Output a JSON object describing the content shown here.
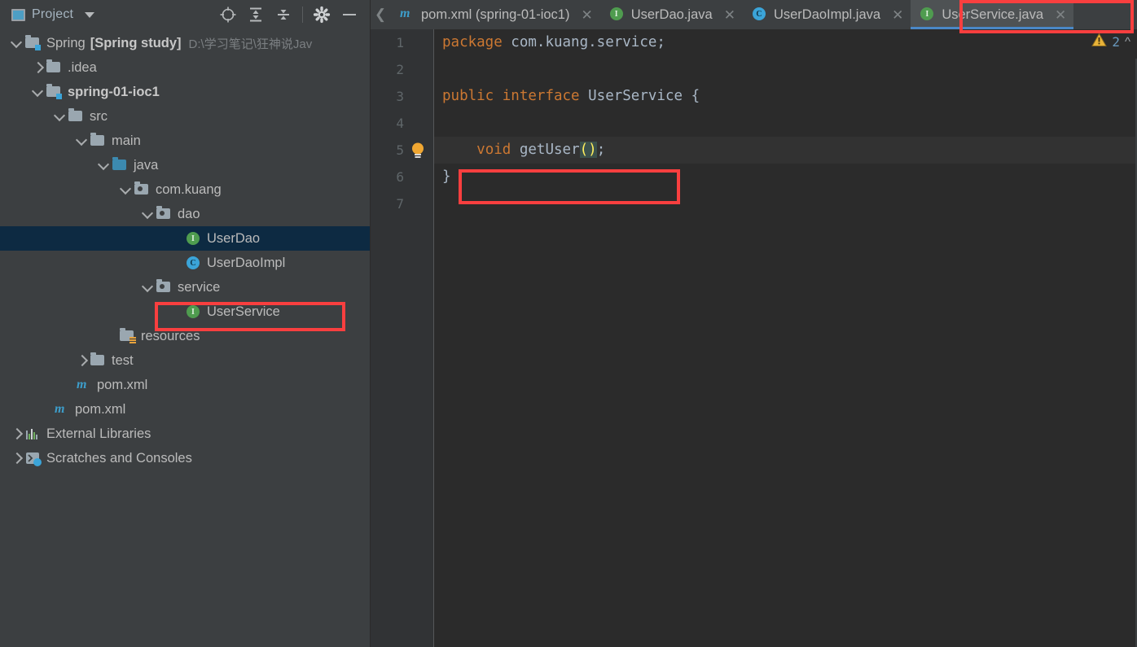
{
  "toolwindow": {
    "title": "Project",
    "window_icon": "project-window-icon",
    "dropdown_icon": "chevron-down-icon",
    "actions": [
      {
        "name": "scroll-from-source-icon",
        "label": "Select Opened File"
      },
      {
        "name": "expand-all-icon",
        "label": "Expand All"
      },
      {
        "name": "collapse-all-icon",
        "label": "Collapse All"
      },
      {
        "name": "gear-icon",
        "label": "Settings"
      },
      {
        "name": "minimize-icon",
        "label": "Hide"
      }
    ]
  },
  "tree": [
    {
      "label": "Spring",
      "bold_label": "[Spring study]",
      "path": "D:\\学习笔记\\狂神说Jav",
      "icon": "module-folder-icon",
      "arrow": "open",
      "depth": 0,
      "selected": false
    },
    {
      "label": ".idea",
      "icon": "folder-icon",
      "arrow": "closed",
      "depth": 1,
      "selected": false
    },
    {
      "label": "spring-01-ioc1",
      "icon": "module-folder-icon",
      "arrow": "open",
      "depth": 1,
      "bold": true,
      "selected": false
    },
    {
      "label": "src",
      "icon": "folder-icon",
      "arrow": "open",
      "depth": 2,
      "selected": false
    },
    {
      "label": "main",
      "icon": "folder-icon",
      "arrow": "open",
      "depth": 3,
      "selected": false
    },
    {
      "label": "java",
      "icon": "source-root-folder-icon",
      "arrow": "open",
      "depth": 4,
      "selected": false
    },
    {
      "label": "com.kuang",
      "icon": "package-icon",
      "arrow": "open",
      "depth": 5,
      "selected": false
    },
    {
      "label": "dao",
      "icon": "package-icon",
      "arrow": "open",
      "depth": 6,
      "selected": false
    },
    {
      "label": "UserDao",
      "icon": "interface-icon",
      "arrow": "none",
      "depth": 7,
      "selected": true
    },
    {
      "label": "UserDaoImpl",
      "icon": "class-icon",
      "arrow": "none",
      "depth": 7,
      "selected": false
    },
    {
      "label": "service",
      "icon": "package-icon",
      "arrow": "open",
      "depth": 6,
      "selected": false
    },
    {
      "label": "UserService",
      "icon": "interface-icon",
      "arrow": "none",
      "depth": 7,
      "selected": false,
      "annotated": true
    },
    {
      "label": "resources",
      "icon": "resources-folder-icon",
      "arrow": "none",
      "depth": 4,
      "selected": false
    },
    {
      "label": "test",
      "icon": "folder-icon",
      "arrow": "closed",
      "depth": 3,
      "selected": false
    },
    {
      "label": "pom.xml",
      "icon": "maven-icon",
      "arrow": "none",
      "depth": 3,
      "selected": false
    },
    {
      "label": "pom.xml",
      "icon": "maven-icon",
      "arrow": "none",
      "depth": 2,
      "selected": false
    },
    {
      "label": "External Libraries",
      "icon": "external-libraries-icon",
      "arrow": "closed",
      "depth": 0,
      "selected": false
    },
    {
      "label": "Scratches and Consoles",
      "icon": "scratches-icon",
      "arrow": "closed",
      "depth": 0,
      "selected": false
    }
  ],
  "editor": {
    "scroll_left_icon": "chevron-left-icon",
    "tabs": [
      {
        "label": "pom.xml (spring-01-ioc1)",
        "icon": "maven-icon",
        "active": false,
        "close_icon": "close-icon"
      },
      {
        "label": "UserDao.java",
        "icon": "interface-icon",
        "active": false,
        "close_icon": "close-icon"
      },
      {
        "label": "UserDaoImpl.java",
        "icon": "class-icon",
        "active": false,
        "close_icon": "close-icon"
      },
      {
        "label": "UserService.java",
        "icon": "interface-icon",
        "active": true,
        "close_icon": "close-icon",
        "annotated": true
      }
    ],
    "line_numbers": [
      "1",
      "2",
      "3",
      "4",
      "5",
      "6",
      "7"
    ],
    "code": {
      "l1_kw": "package",
      "l1_pkg": " com.kuang.service;",
      "l3_kw1": "public",
      "l3_kw2": "interface",
      "l3_name": " UserService ",
      "l3_brace": "{",
      "l5_indent": "    ",
      "l5_kw": "void",
      "l5_name": " getUser",
      "l5_parens": "()",
      "l5_semi": ";",
      "l6_brace": "}"
    },
    "gutter_bulb_icon": "intention-bulb-icon",
    "inspection": {
      "warning_icon": "warning-triangle-icon",
      "warning_count": "2",
      "collapse_icon": "chevron-up-icon"
    }
  },
  "colors": {
    "accent_blue": "#4a88c7",
    "annotation_red": "#f93f3f",
    "keyword_orange": "#cc7832",
    "selection_navy": "#0d2a42",
    "interface_green": "#4f9c4f",
    "class_blue": "#3ba4d8",
    "warning_yellow": "#e8b339"
  }
}
